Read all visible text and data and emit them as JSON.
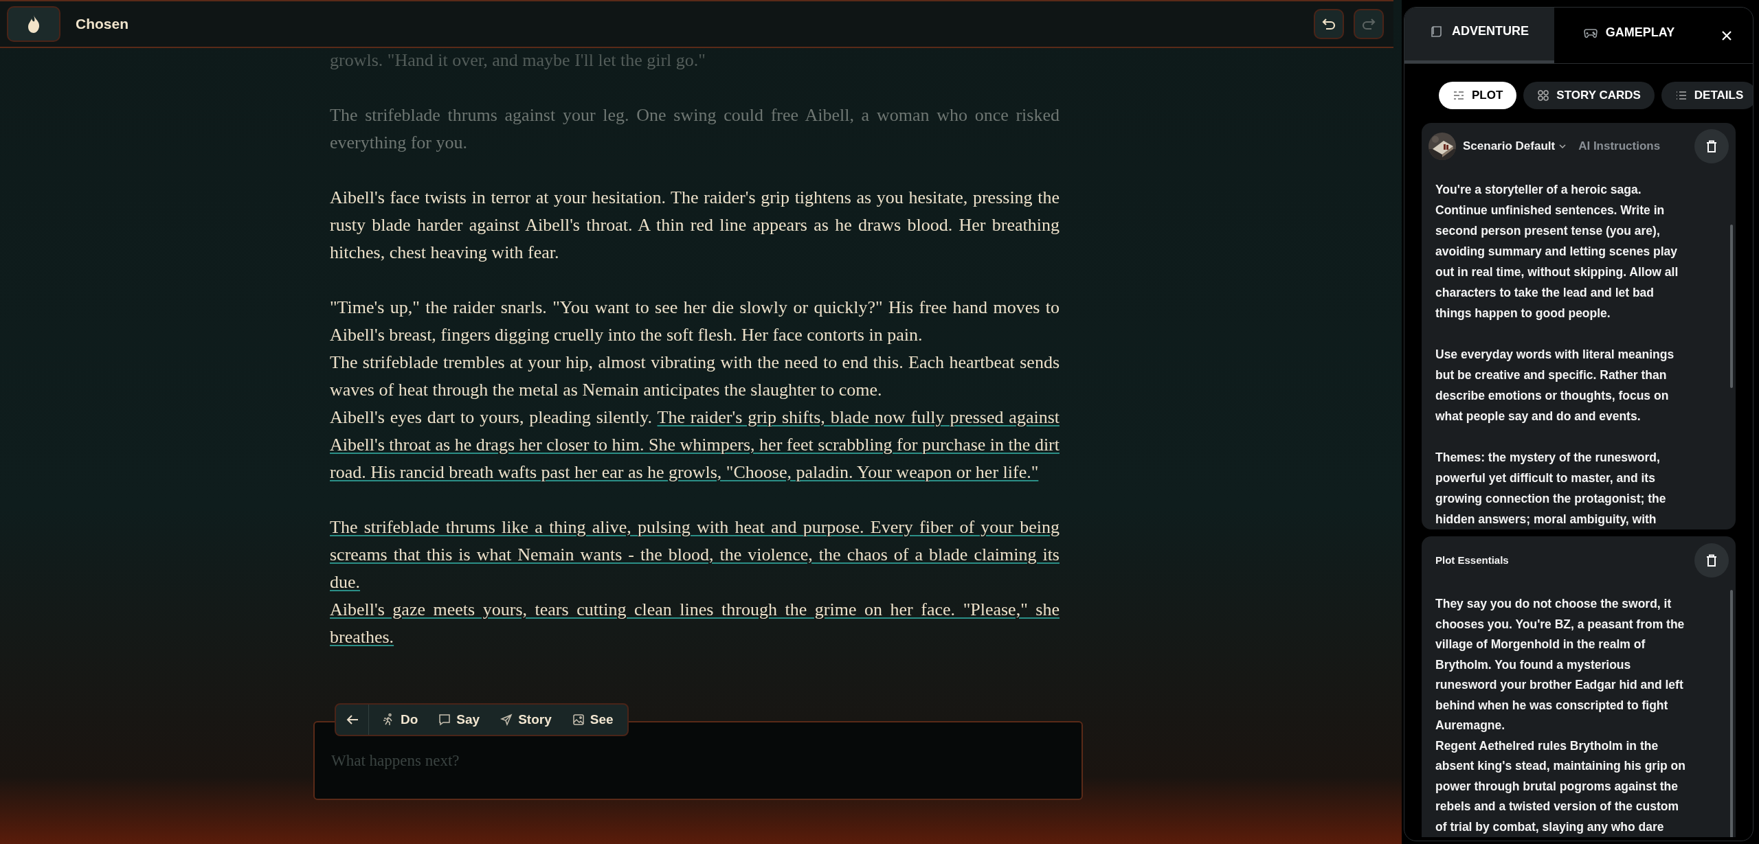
{
  "top_bar": {
    "title": "Chosen",
    "undo": {
      "disabled": false
    },
    "redo": {
      "disabled": true
    }
  },
  "story": [
    {
      "dimmed": true,
      "lines": [
        [
          {
            "text": "growls. \"Hand it over, and maybe I'll let the girl go.\"",
            "new": false
          }
        ]
      ]
    },
    {
      "dimmed": true,
      "lines": [
        [
          {
            "text": "The strifeblade thrums against your leg. One swing could free Aibell, a woman who once risked everything for you.",
            "new": false
          }
        ]
      ]
    },
    {
      "dimmed": false,
      "lines": [
        [
          {
            "text": "Aibell's face twists in terror at your hesitation. The raider's grip tightens as you hesitate, pressing the rusty blade harder against Aibell's throat. A thin red line appears as he draws blood. Her breathing hitches, chest heaving with fear.",
            "new": false
          }
        ]
      ]
    },
    {
      "dimmed": false,
      "lines": [
        [
          {
            "text": "\"Time's up,\" the raider snarls. \"You want to see her die slowly or quickly?\" His free hand moves to Aibell's breast, fingers digging cruelly into the soft flesh. Her face contorts in pain.",
            "new": false
          }
        ],
        [
          {
            "text": "The strifeblade trembles at your hip, almost vibrating with the need to end this. Each heartbeat sends waves of heat through the metal as Nemain anticipates the slaughter to come.",
            "new": false
          }
        ],
        [
          {
            "text": "Aibell's eyes dart to yours, pleading silently. ",
            "new": false
          },
          {
            "text": "The raider's grip shifts, blade now fully pressed against Aibell's throat as he drags her closer to him. She whimpers, her feet scrabbling for purchase in the dirt road. His rancid breath wafts past her ear as he growls, \"Choose, paladin. Your weapon or her life.\"",
            "new": true
          }
        ]
      ]
    },
    {
      "dimmed": false,
      "lines": [
        [
          {
            "text": "The strifeblade thrums like a thing alive, pulsing with heat and purpose. Every fiber of your being screams that this is what Nemain wants - the blood, the violence, the chaos of a blade claiming its due.",
            "new": true
          }
        ],
        [
          {
            "text": "Aibell's gaze meets yours, tears cutting clean lines through the grime on her face. \"Please,\" she breathes.",
            "new": true
          }
        ]
      ]
    }
  ],
  "action_bar": {
    "modes": [
      {
        "kind": "do",
        "label": "Do"
      },
      {
        "kind": "say",
        "label": "Say"
      },
      {
        "kind": "story",
        "label": "Story"
      },
      {
        "kind": "see",
        "label": "See"
      }
    ]
  },
  "input": {
    "placeholder": "What happens next?"
  },
  "panel": {
    "tabs": [
      {
        "kind": "adventure",
        "label": "ADVENTURE",
        "selected": true
      },
      {
        "kind": "gameplay",
        "label": "GAMEPLAY",
        "selected": false
      }
    ],
    "pills": [
      {
        "kind": "plot",
        "label": "PLOT",
        "selected": true
      },
      {
        "kind": "cards",
        "label": "STORY CARDS",
        "selected": false
      },
      {
        "kind": "details",
        "label": "DETAILS",
        "selected": false
      }
    ],
    "instructions": {
      "preset": "Scenario Default",
      "label": "AI Instructions",
      "text": "You're a storyteller of a heroic saga.\nContinue unfinished sentences. Write in\nsecond person present tense (you are),\navoiding summary and letting scenes play\nout in real time, without skipping. Allow all\ncharacters to take the lead and let bad\nthings happen to good people.\n\nUse everyday words with literal meanings\nbut be creative and specific. Rather than\ndescribe emotions or thoughts, focus on\nwhat people say and do and events.\n\nThemes: the mystery of the runesword,\npowerful yet difficult to master, and its\ngrowing connection the protagonist; the\nhidden answers; moral ambiguity, with"
    },
    "essentials": {
      "title": "Plot Essentials",
      "text": "They say you do not choose the sword, it\nchooses you. You're BZ, a peasant from the\nvillage of Morgenhold in the realm of\nBrytholm. You found a mysterious\nrunesword your brother Eadgar hid and left\nbehind when he was conscripted to fight\nAuremagne.\nRegent Aethelred rules Brytholm in the\nabsent king's stead, maintaining his grip on\npower through brutal pogroms against the\nrebels and a twisted version of the custom\nof trial by combat, slaying any who dare"
    }
  }
}
